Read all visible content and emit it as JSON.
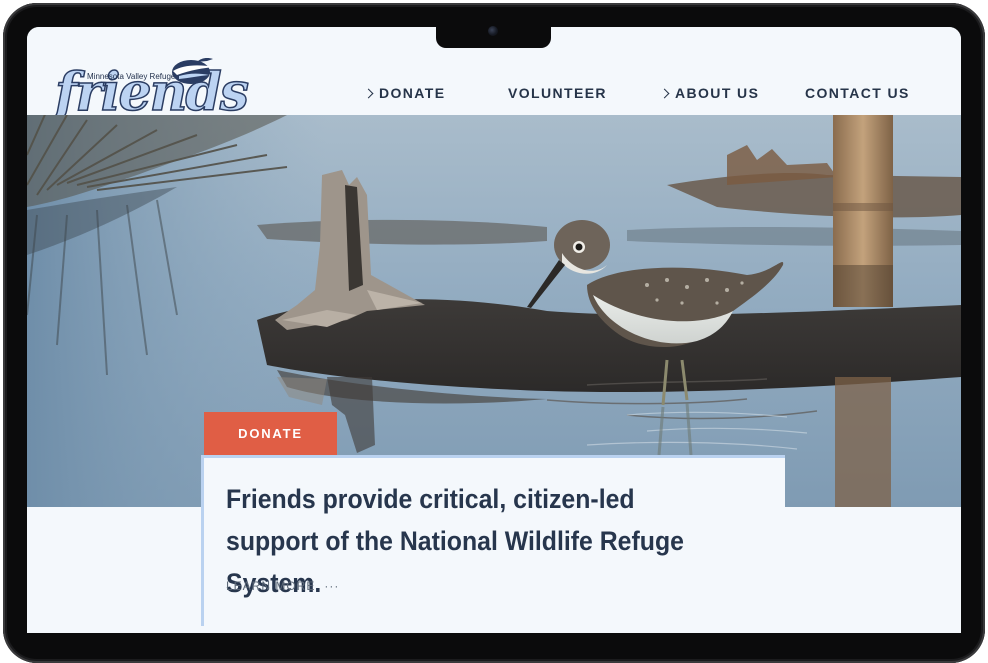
{
  "logo": {
    "tagline": "Minnesota Valley Refuge",
    "wordmark": "friends"
  },
  "nav": {
    "items": [
      {
        "label": "DONATE",
        "has_chevron": true
      },
      {
        "label": "VOLUNTEER",
        "has_chevron": false
      },
      {
        "label": "ABOUT US",
        "has_chevron": true
      },
      {
        "label": "CONTACT US",
        "has_chevron": false
      }
    ]
  },
  "hero": {
    "image": "sandpiper-wading-in-wetland-photo"
  },
  "card": {
    "tab_label": "DONATE",
    "headline": "Friends provide critical, citizen-led support of the National Wildlife Refuge System.",
    "link_label": "LEARN MORE",
    "link_icon": "more-dots-icon"
  },
  "colors": {
    "page_bg": "#f4f8fc",
    "accent": "#e05e45",
    "card_border": "#bad2f0",
    "text_dark": "#27364d"
  }
}
